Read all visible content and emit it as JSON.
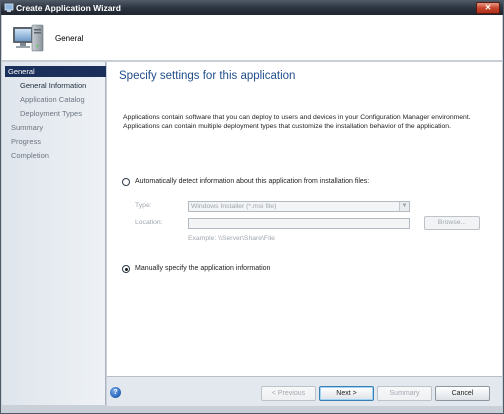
{
  "window": {
    "title": "Create Application Wizard",
    "close_symbol": "✕"
  },
  "header": {
    "icon": "computer-icon",
    "title": "General"
  },
  "sidebar": {
    "items": [
      {
        "label": "General",
        "state": "selected"
      },
      {
        "label": "General Information",
        "state": "active-sub"
      },
      {
        "label": "Application Catalog",
        "state": "inactive"
      },
      {
        "label": "Deployment Types",
        "state": "inactive"
      },
      {
        "label": "Summary",
        "state": "inactive"
      },
      {
        "label": "Progress",
        "state": "inactive"
      },
      {
        "label": "Completion",
        "state": "inactive"
      }
    ]
  },
  "main": {
    "heading": "Specify settings for this application",
    "description": "Applications contain software that you can deploy to users and devices in your Configuration Manager environment. Applications can contain multiple deployment types that customize the installation behavior of the application.",
    "auto_detect": {
      "label": "Automatically detect information about this application from installation files:",
      "selected": false,
      "type_label": "Type:",
      "type_value": "Windows Installer (*.msi file)",
      "location_label": "Location:",
      "location_value": "",
      "browse_label": "Browse...",
      "example": "Example:  \\\\Server\\Share\\File"
    },
    "manual": {
      "label": "Manually specify the application information",
      "selected": true
    }
  },
  "footer": {
    "help_symbol": "?",
    "previous_label": "< Previous",
    "next_label": "Next >",
    "summary_label": "Summary",
    "cancel_label": "Cancel"
  },
  "colors": {
    "heading": "#1f4e8c",
    "nav_selected_bg": "#1a2f5a",
    "titlebar": "#2c3440"
  }
}
